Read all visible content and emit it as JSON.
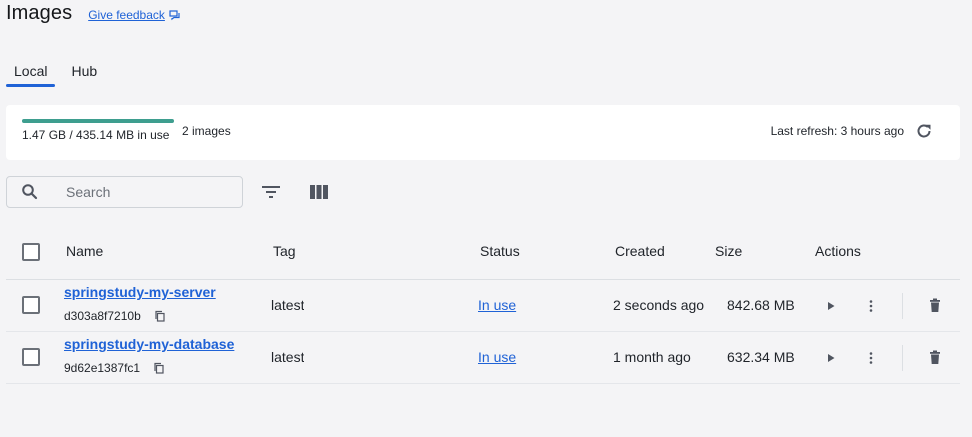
{
  "header": {
    "title": "Images",
    "feedback_label": "Give feedback"
  },
  "tabs": [
    {
      "label": "Local",
      "active": true
    },
    {
      "label": "Hub",
      "active": false
    }
  ],
  "summary": {
    "usage_text": "1.47 GB / 435.14 MB in use",
    "usage_fraction": 1.0,
    "image_count": "2 images",
    "last_refresh": "Last refresh: 3 hours ago"
  },
  "search": {
    "value": "",
    "placeholder": "Search"
  },
  "table": {
    "columns": [
      "Name",
      "Tag",
      "Status",
      "Created",
      "Size",
      "Actions"
    ],
    "rows": [
      {
        "name": "springstudy-my-server",
        "id": "d303a8f7210b",
        "tag": "latest",
        "status": "In use",
        "created": "2 seconds ago",
        "size": "842.68 MB"
      },
      {
        "name": "springstudy-my-database",
        "id": "9d62e1387fc1",
        "tag": "latest",
        "status": "In use",
        "created": "1 month ago",
        "size": "632.34 MB"
      }
    ]
  },
  "colors": {
    "accent": "#1f62d6",
    "usage_bar": "#3e9e8f",
    "background": "#f4f4f6"
  },
  "icons": {
    "feedback": "feedback-icon",
    "refresh": "refresh-icon",
    "search": "search-icon",
    "filter": "filter-icon",
    "columns": "columns-icon",
    "copy": "copy-icon",
    "play": "play-icon",
    "more": "more-vertical-icon",
    "delete": "trash-icon"
  }
}
